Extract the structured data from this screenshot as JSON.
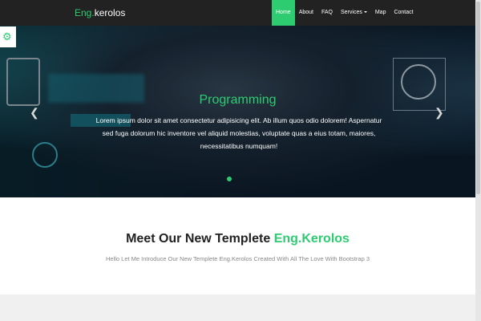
{
  "navbar": {
    "brand_accent": "Eng.",
    "brand_rest": "kerolos",
    "items": [
      {
        "label": "Home",
        "active": true
      },
      {
        "label": "About"
      },
      {
        "label": "FAQ"
      },
      {
        "label": "Services"
      },
      {
        "label": "Map"
      },
      {
        "label": "Contact"
      }
    ]
  },
  "settings": {
    "icon": "gear-icon"
  },
  "hero": {
    "title": "Programming",
    "text": "Lorem ipsum dolor sit amet consectetur adipisicing elit. Ab illum quos odio dolorem! Aspernatur sed fuga dolorum hic inventore vel aliquid molestias, voluptate quas a eius totam, maiores, necessitatibus numquam!",
    "prev_icon": "chevron-left-icon",
    "next_icon": "chevron-right-icon"
  },
  "intro": {
    "title_main": "Meet Our New Templete ",
    "title_accent": "Eng.Kerolos",
    "subtitle": "Hello Let Me Introduce Our New Templete Eng.Kerolos Created With All The Love With Bootstrap 3"
  },
  "colors": {
    "accent": "#2ecc71",
    "navbar_bg": "#222222"
  }
}
